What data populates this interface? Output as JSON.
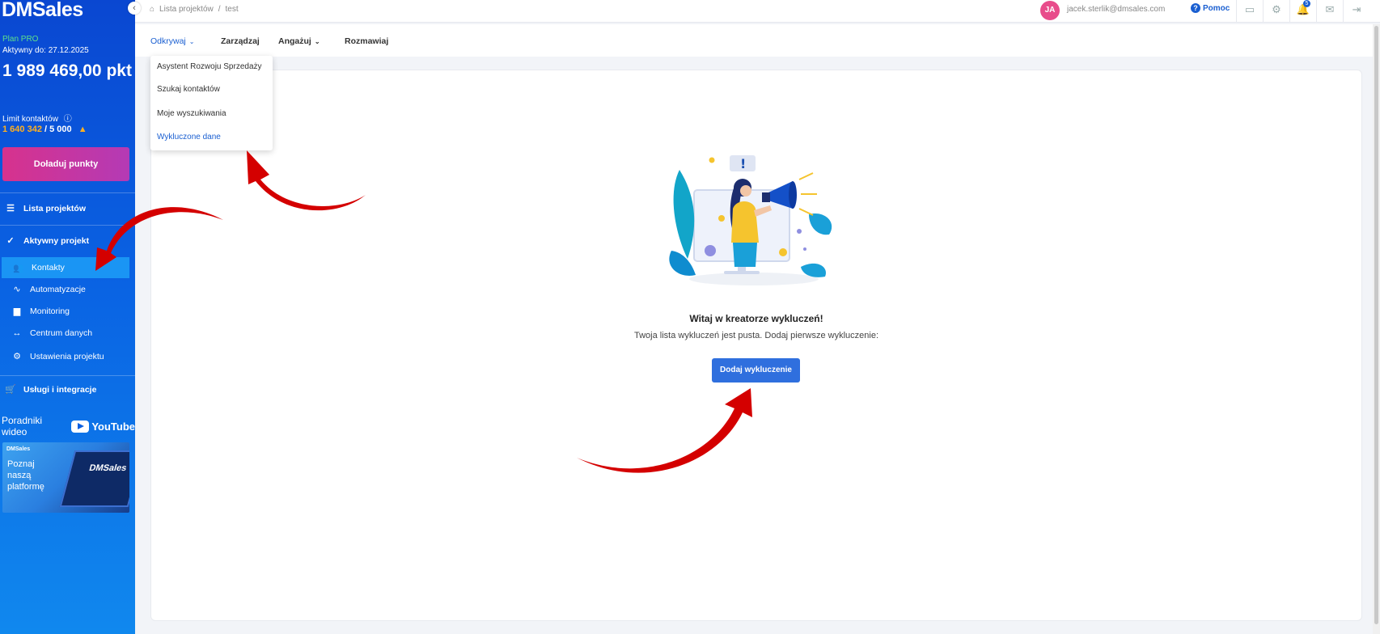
{
  "sidebar": {
    "logo": "DMSales",
    "plan": "Plan PRO",
    "active_until": "Aktywny do: 27.12.2025",
    "points": "1 989 469,00 pkt",
    "limit_label": "Limit kontaktów",
    "limit_used": "1 640 342",
    "limit_total": "/ 5 000",
    "topup_label": "Doładuj punkty",
    "nav": {
      "projects": "Lista projektów",
      "active_project": "Aktywny projekt",
      "contacts": "Kontakty",
      "automations": "Automatyzacje",
      "monitoring": "Monitoring",
      "data_center": "Centrum danych",
      "project_settings": "Ustawienia projektu",
      "services": "Usługi i integracje"
    },
    "tutorials_label": "Poradniki wideo",
    "youtube_label": "YouTube",
    "promo": {
      "brand": "DMSales",
      "text": "Poznaj naszą platformę",
      "screen_text": "DMSales"
    }
  },
  "topbar": {
    "breadcrumb_root": "Lista projektów",
    "breadcrumb_sep": "/",
    "breadcrumb_current": "test",
    "avatar_initials": "JA",
    "email": "jacek.sterlik@dmsales.com",
    "help_label": "Pomoc",
    "notification_count": "5"
  },
  "tabs": {
    "discover": "Odkrywaj",
    "manage": "Zarządzaj",
    "engage": "Angażuj",
    "talk": "Rozmawiaj"
  },
  "dropdown": {
    "items": [
      "Asystent Rozwoju Sprzedaży",
      "Szukaj kontaktów",
      "Moje wyszukiwania",
      "Wykluczone dane"
    ]
  },
  "main": {
    "title": "Witaj w kreatorze wykluczeń!",
    "subtitle": "Twoja lista wykluczeń jest pusta. Dodaj pierwsze wykluczenie:",
    "add_button": "Dodaj wykluczenie"
  },
  "colors": {
    "sidebar_blue": "#0a47d1",
    "accent": "#2f6fde",
    "topup_pink": "#d7328d",
    "warning": "#ffb020",
    "annotation_red": "#d40000"
  }
}
